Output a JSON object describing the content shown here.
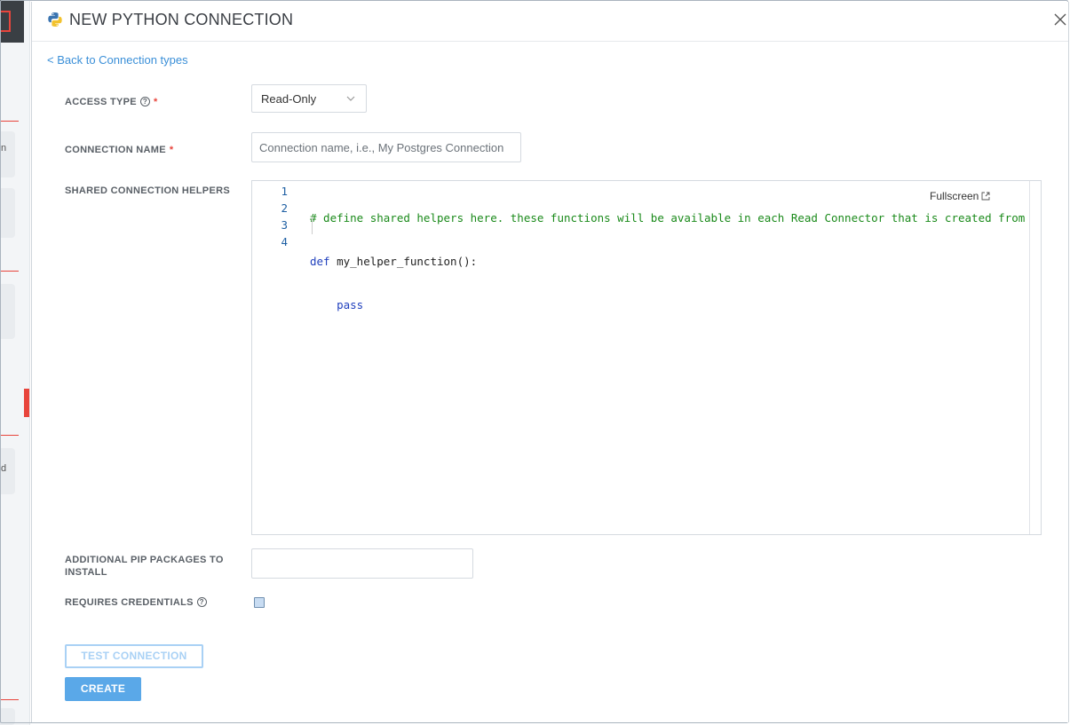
{
  "modal": {
    "title": "NEW PYTHON CONNECTION",
    "back_link": "< Back to Connection types"
  },
  "form": {
    "access_type": {
      "label": "ACCESS TYPE",
      "required_mark": "*",
      "selected": "Read-Only"
    },
    "connection_name": {
      "label": "CONNECTION NAME",
      "required_mark": "*",
      "placeholder": "Connection name, i.e., My Postgres Connection",
      "value": ""
    },
    "shared_helpers": {
      "label": "SHARED CONNECTION HELPERS",
      "fullscreen_label": "Fullscreen",
      "line_numbers": [
        "1",
        "2",
        "3",
        "4"
      ],
      "code_lines": [
        "# define shared helpers here. these functions will be available in each Read Connector that is created from",
        "def",
        " my_helper_function():",
        "    pass"
      ]
    },
    "pip_packages": {
      "label_line1": "ADDITIONAL PIP PACKAGES TO",
      "label_line2": "INSTALL",
      "value": ""
    },
    "requires_credentials": {
      "label": "REQUIRES CREDENTIALS",
      "checked": false
    }
  },
  "buttons": {
    "test": "TEST CONNECTION",
    "create": "CREATE"
  },
  "background": {
    "fragments": [
      "n",
      "d"
    ]
  },
  "colors": {
    "accent": "#3a8fd8",
    "required": "#e8453c",
    "create_button": "#5aa8e8",
    "test_button_border": "#a9d1f5",
    "comment": "#1a8a1a",
    "keyword": "#1f3fbd"
  },
  "icons": {
    "python": "python-logo-icon",
    "close": "close-icon",
    "help": "help-circle-icon",
    "dropdown": "chevron-down-icon",
    "fullscreen": "external-link-icon"
  }
}
